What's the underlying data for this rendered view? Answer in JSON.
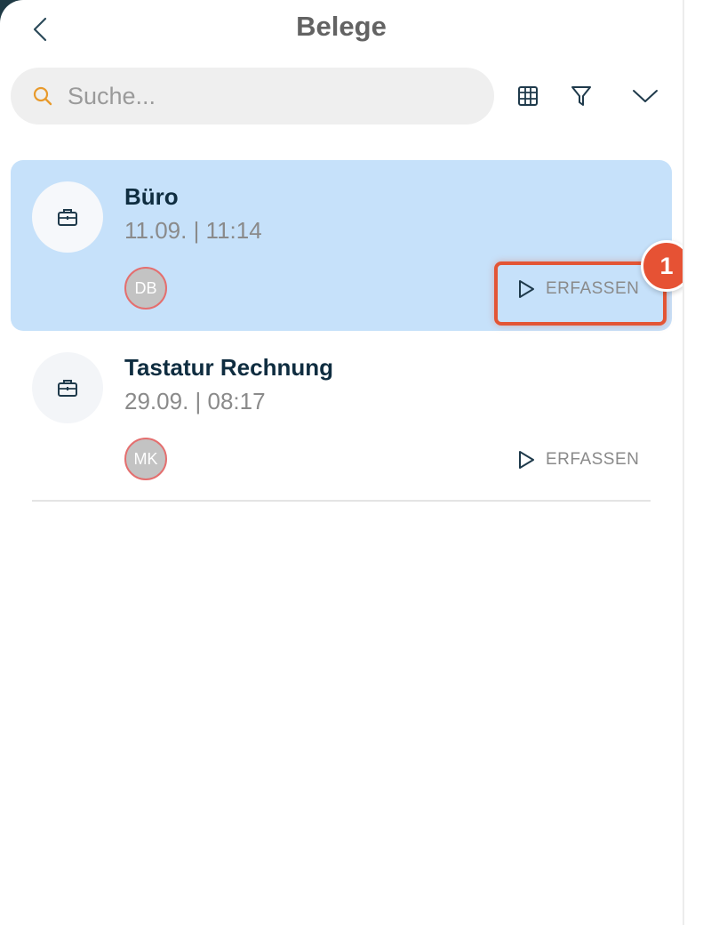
{
  "header": {
    "title": "Belege",
    "back_icon": "chevron-left-icon"
  },
  "search": {
    "placeholder": "Suche...",
    "value": "",
    "icon": "search-icon",
    "icon_color": "#e89a2c"
  },
  "toolbar": {
    "grid_icon": "grid-icon",
    "filter_icon": "filter-icon",
    "expand_icon": "chevron-down-icon"
  },
  "list": {
    "items": [
      {
        "title": "Büro",
        "date": "11.09. | 11:14",
        "avatar": "DB",
        "action_label": "ERFASSEN",
        "selected": true,
        "icon": "briefcase-icon"
      },
      {
        "title": "Tastatur Rechnung",
        "date": "29.09. | 08:17",
        "avatar": "MK",
        "action_label": "ERFASSEN",
        "selected": false,
        "icon": "briefcase-icon"
      }
    ]
  },
  "annotation": {
    "badge": "1"
  },
  "colors": {
    "selected_row": "#c6e1fa",
    "highlight": "#e35535",
    "title": "#0f2d40"
  }
}
